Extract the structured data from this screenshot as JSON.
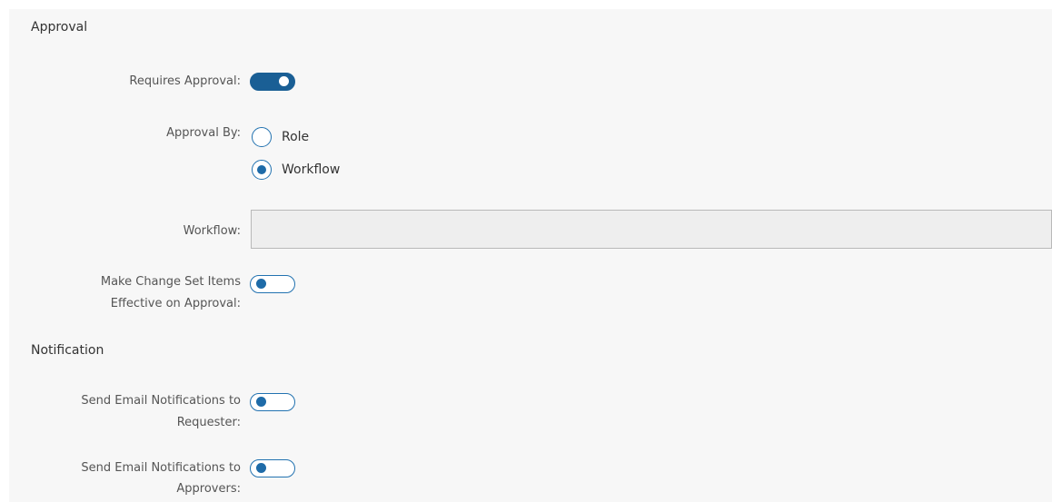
{
  "approval": {
    "title": "Approval",
    "requires_approval": {
      "label": "Requires Approval:",
      "on": true
    },
    "approval_by": {
      "label": "Approval By:",
      "options": [
        {
          "label": "Role",
          "selected": false
        },
        {
          "label": "Workflow",
          "selected": true
        }
      ]
    },
    "workflow": {
      "label": "Workflow:",
      "value": ""
    },
    "effective_on_approval": {
      "label_line1": "Make Change Set Items",
      "label_line2": "Effective on Approval:",
      "on": false
    }
  },
  "notification": {
    "title": "Notification",
    "notify_requester": {
      "label_line1": "Send Email Notifications to",
      "label_line2": "Requester:",
      "on": false
    },
    "notify_approvers": {
      "label_line1": "Send Email Notifications to",
      "label_line2": "Approvers:",
      "on": false
    }
  },
  "colors": {
    "toggle_on": "#1a5f95",
    "accent": "#2272b0",
    "panel_bg": "#f7f7f7"
  }
}
